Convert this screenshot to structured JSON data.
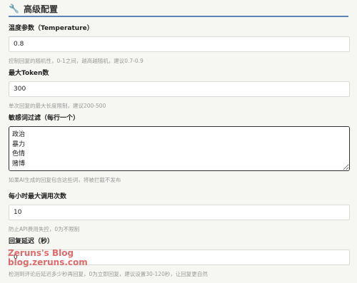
{
  "section": {
    "icon": "wrench-icon",
    "title": "高级配置"
  },
  "fields": {
    "temperature": {
      "label": "温度参数（Temperature）",
      "value": "0.8",
      "help": "控制回复的随机性，0-1之间，越高越随机，建议0.7-0.9"
    },
    "max_tokens": {
      "label": "最大Token数",
      "value": "300",
      "help": "单次回复的最大长度限制，建议200-500"
    },
    "sensitive_filter": {
      "label": "敏感词过滤（每行一个）",
      "value": "政治\n暴力\n色情\n赌博",
      "help": "如果AI生成的回复包含这些词，将被拦截不发布"
    },
    "hourly_limit": {
      "label": "每小时最大调用次数",
      "value": "10",
      "help": "防止API费用失控，0为不限制"
    },
    "reply_delay": {
      "label": "回复延迟（秒）",
      "value": "0",
      "help": "检测到评论后延迟多少秒再回复，0为立即回复，建议设置30-120秒，让回复更自然"
    }
  },
  "watermark": {
    "line1": "Zeruns's Blog",
    "line2": "blog.zeruns.com"
  },
  "colors": {
    "header_rule": "#5b87b8",
    "watermark": "#e05050"
  }
}
